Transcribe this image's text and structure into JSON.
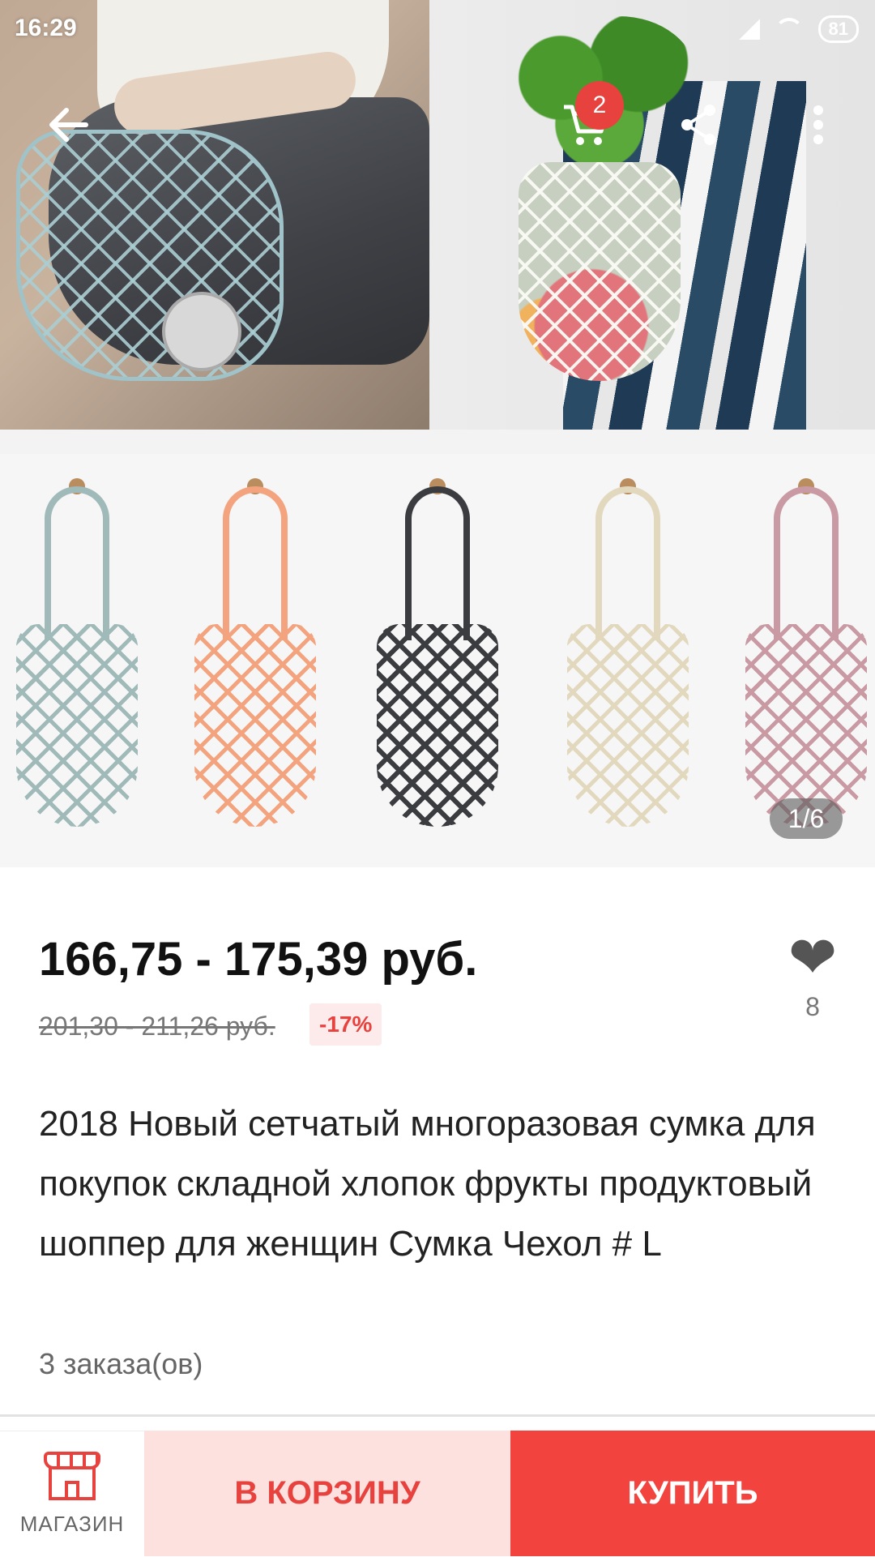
{
  "status_bar": {
    "time": "16:29",
    "battery": "81"
  },
  "nav": {
    "cart_badge": "2"
  },
  "gallery": {
    "counter": "1/6",
    "colors": [
      "#9fbab8",
      "#f3a47f",
      "#3a3c40",
      "#efe6cf",
      "#c99aa4"
    ]
  },
  "product": {
    "price": "166,75 - 175,39 руб.",
    "old_price": "201,30 - 211,26 руб.",
    "discount": "-17%",
    "likes": "8",
    "title": "2018 Новый сетчатый многоразовая сумка для покупок складной хлопок фрукты продуктовый шоппер для женщин Сумка Чехол # L",
    "orders": "3 заказа(ов)"
  },
  "bottom_bar": {
    "shop_label": "МАГАЗИН",
    "add_to_cart": "В КОРЗИНУ",
    "buy": "КУПИТЬ"
  },
  "theme": {
    "accent": "#f2433f",
    "accent_light": "#fde1df"
  }
}
